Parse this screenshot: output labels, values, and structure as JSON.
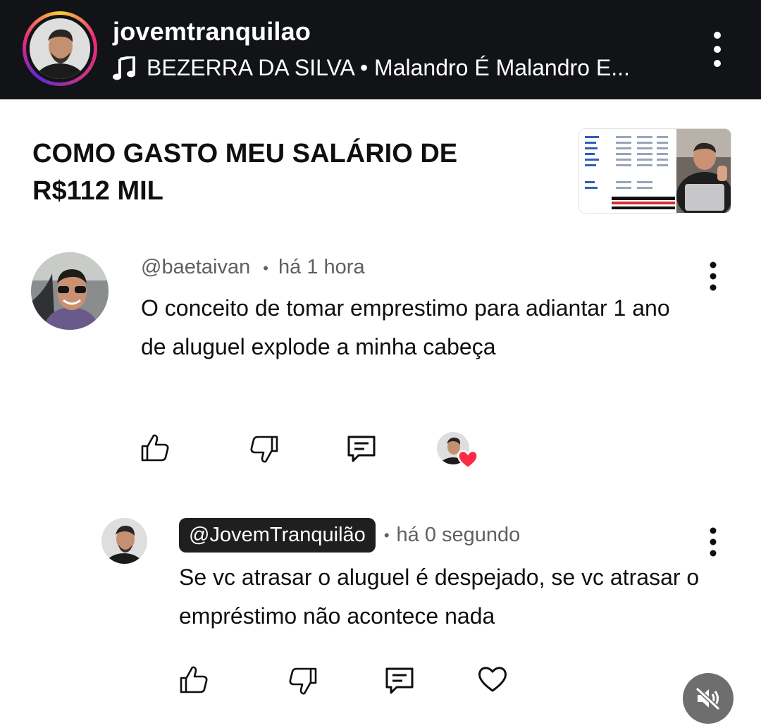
{
  "story": {
    "username": "jovemtranquilao",
    "music": "BEZERRA DA SILVA • Malandro É Malandro E...",
    "icons": {
      "music": "music-note-icon",
      "menu": "more-vertical-icon"
    },
    "ring_colors": [
      "#f9ce34",
      "#ee2a7b",
      "#6228d7"
    ]
  },
  "video": {
    "title_line1": "COMO GASTO MEU SALÁRIO DE",
    "title_line2": "R$112 MIL"
  },
  "comments": [
    {
      "handle": "@baetaivan",
      "separator": "•",
      "time": "há 1 hora",
      "text": "O conceito de tomar emprestimo para adiantar 1 ano de aluguel explode a minha cabeça",
      "icons": [
        "thumb-up-icon",
        "thumb-down-icon",
        "reply-icon",
        "creator-heart-icon"
      ]
    },
    {
      "handle": "@JovemTranquilão",
      "separator": "•",
      "time": "há 0 segundo",
      "text": "Se vc atrasar o aluguel é despejado, se vc atrasar o empréstimo não acontece nada",
      "icons": [
        "thumb-up-icon",
        "thumb-down-icon",
        "reply-icon",
        "heart-outline-icon"
      ]
    }
  ],
  "overlay": {
    "icon": "muted-speaker-icon"
  },
  "colors": {
    "header_bg": "#111316",
    "meta_text": "#606060",
    "heart": "#ff2a45",
    "chip_bg": "#1f1f1f"
  }
}
